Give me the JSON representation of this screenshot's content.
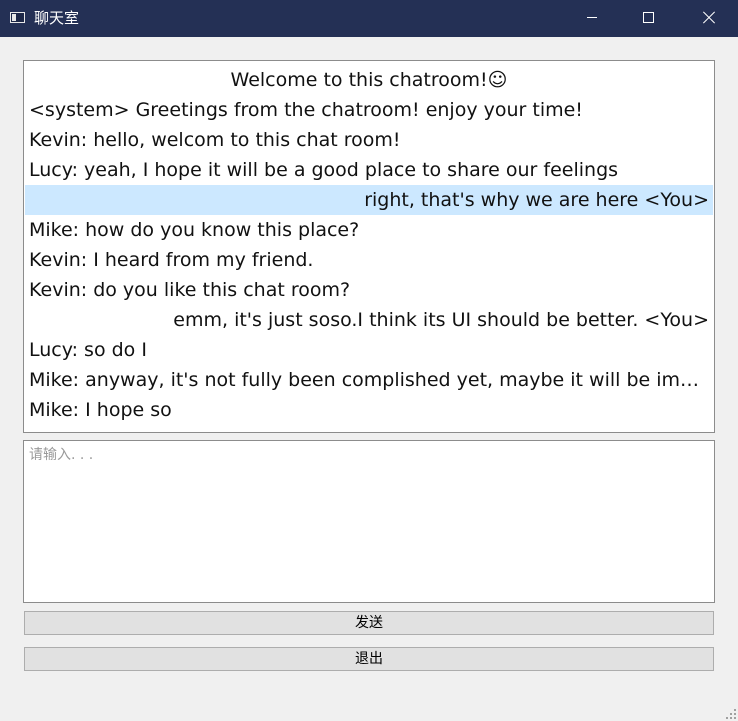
{
  "window": {
    "title": "聊天室"
  },
  "chat": {
    "messages": [
      {
        "text": "Welcome to this chatroom!☺",
        "align": "center",
        "selected": false
      },
      {
        "text": "<system> Greetings from the chatroom! enjoy your time!",
        "align": "left",
        "selected": false
      },
      {
        "text": "Kevin: hello, welcom to this chat room!",
        "align": "left",
        "selected": false
      },
      {
        "text": "Lucy: yeah, I hope it will be a good place to share our feelings",
        "align": "left",
        "selected": false
      },
      {
        "text": "right, that's why we are here <You>",
        "align": "right",
        "selected": true
      },
      {
        "text": "Mike: how do you know this place?",
        "align": "left",
        "selected": false
      },
      {
        "text": "Kevin: I heard from my friend.",
        "align": "left",
        "selected": false
      },
      {
        "text": "Kevin: do you like this chat room?",
        "align": "left",
        "selected": false
      },
      {
        "text": "emm, it's just soso.I think its UI should be better. <You>",
        "align": "right",
        "selected": false
      },
      {
        "text": "Lucy: so do I",
        "align": "left",
        "selected": false
      },
      {
        "text": "Mike: anyway, it's not fully been complished yet, maybe it will be improved l...",
        "align": "left",
        "selected": false
      },
      {
        "text": "Mike: I hope so",
        "align": "left",
        "selected": false
      }
    ]
  },
  "input": {
    "value": "",
    "placeholder": "请输入. . ."
  },
  "buttons": {
    "send_label": "发送",
    "exit_label": "退出"
  },
  "colors": {
    "titlebar": "#243055",
    "selection": "#cce8ff",
    "button_face": "#e1e1e1"
  },
  "icons": {
    "app": "window-icon",
    "minimize": "minimize-icon",
    "maximize": "maximize-icon",
    "close": "close-icon",
    "grip": "size-grip-icon"
  }
}
